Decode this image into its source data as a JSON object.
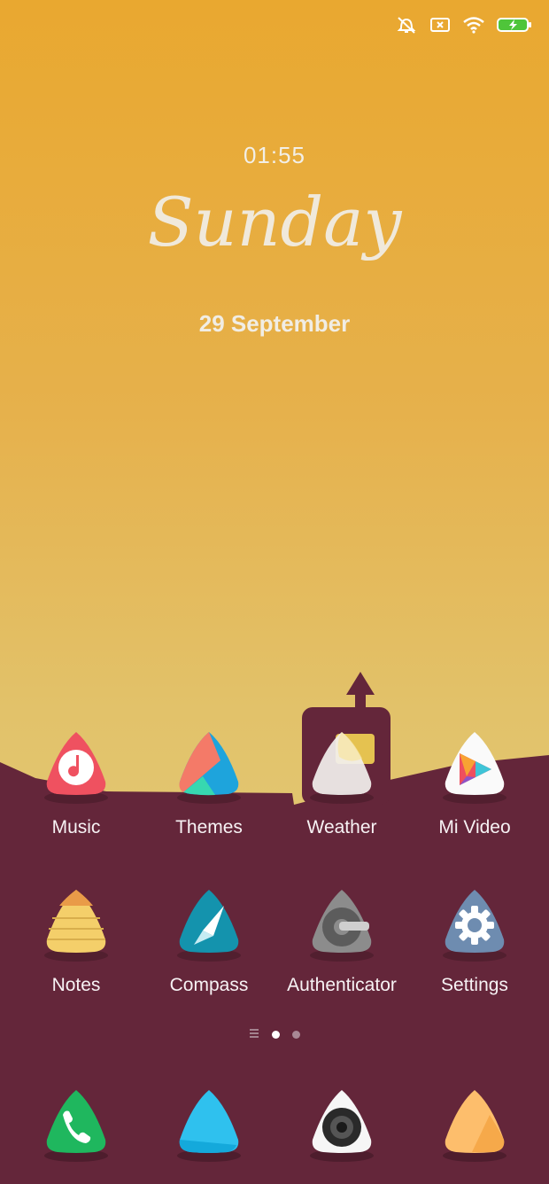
{
  "status_icons": [
    "silent-bell-icon",
    "sim-x-icon",
    "wifi-icon",
    "battery-charging-icon"
  ],
  "lockscreen": {
    "time": "01:55",
    "day": "Sunday",
    "date": "29 September"
  },
  "apps_row1": [
    {
      "label": "Music",
      "icon": "music-icon"
    },
    {
      "label": "Themes",
      "icon": "themes-icon"
    },
    {
      "label": "Weather",
      "icon": "weather-icon"
    },
    {
      "label": "Mi Video",
      "icon": "mi-video-icon"
    }
  ],
  "apps_row2": [
    {
      "label": "Notes",
      "icon": "notes-icon"
    },
    {
      "label": "Compass",
      "icon": "compass-icon"
    },
    {
      "label": "Authenticator",
      "icon": "authenticator-icon"
    },
    {
      "label": "Settings",
      "icon": "settings-icon"
    }
  ],
  "pager": {
    "pages": 2,
    "current": 1,
    "has_menu_page": true
  },
  "dock": [
    "phone-icon",
    "messages-icon",
    "camera-icon",
    "browser-icon"
  ],
  "colors": {
    "sky_top": "#e9a830",
    "sky_bottom": "#dfc672",
    "ground": "#64263a"
  }
}
